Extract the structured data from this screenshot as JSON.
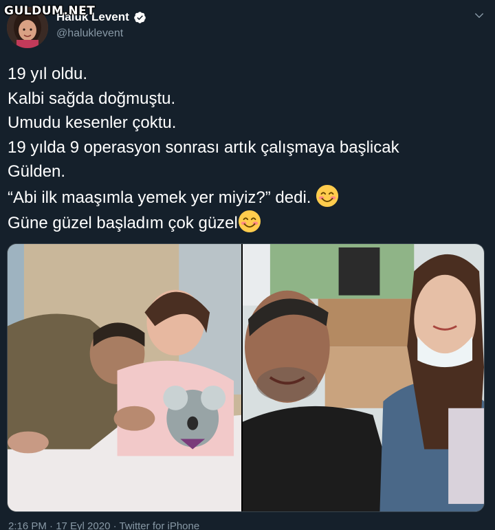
{
  "watermark": "GULDUM.NET",
  "user": {
    "display_name": "Haluk Levent",
    "handle": "@haluklevent",
    "verified_icon": "verified-badge-icon",
    "avatar_icon": "avatar"
  },
  "menu_icon": "chevron-down-icon",
  "tweet": {
    "lines": [
      "19 yıl oldu.",
      "Kalbi sağda doğmuştu.",
      "Umudu kesenler çoktu.",
      "19 yılda 9 operasyon sonrası artık çalışmaya başlicak",
      "Gülden.",
      "“Abi ilk maaşımla yemek yer miyiz?” dedi. ",
      "Güne güzel başladım çok güzel"
    ],
    "emoji": "smiling-face-emoji"
  },
  "media": {
    "left_photo": "childhood-photo",
    "right_photo": "selfie-photo"
  },
  "timestamp": "2:16 PM · 17 Eyl 2020 · Twitter for iPhone"
}
